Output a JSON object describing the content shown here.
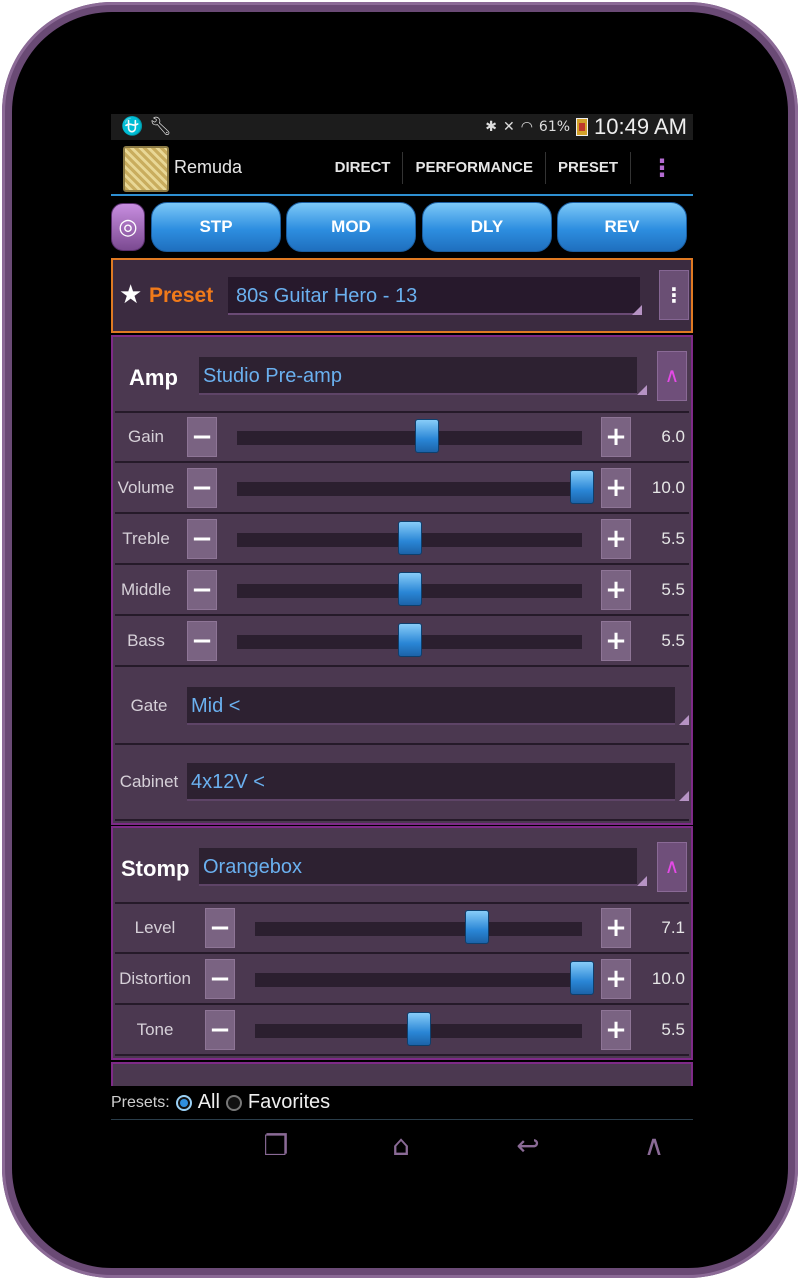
{
  "status_bar": {
    "left_icons": [
      "usb-icon",
      "wrench-icon"
    ],
    "right_icons": [
      "bluetooth-icon",
      "mute-icon",
      "wifi-icon"
    ],
    "battery": "61%",
    "time": "10:49 AM"
  },
  "action_bar": {
    "app_title": "Remuda",
    "items": [
      "DIRECT",
      "PERFORMANCE",
      "PRESET"
    ],
    "overflow": "⋮"
  },
  "tabs": [
    "STP",
    "MOD",
    "DLY",
    "REV"
  ],
  "preset": {
    "label": "Preset",
    "value": "80s Guitar Hero - 13",
    "menu": "⋮"
  },
  "amp": {
    "title": "Amp",
    "model": "Studio Pre-amp",
    "sliders": [
      {
        "label": "Gain",
        "value": "6.0",
        "level": 0.55
      },
      {
        "label": "Volume",
        "value": "10.0",
        "level": 1.0
      },
      {
        "label": "Treble",
        "value": "5.5",
        "level": 0.5
      },
      {
        "label": "Middle",
        "value": "5.5",
        "level": 0.5
      },
      {
        "label": "Bass",
        "value": "5.5",
        "level": 0.5
      }
    ],
    "gate": {
      "label": "Gate",
      "value": "Mid <"
    },
    "cabinet": {
      "label": "Cabinet",
      "value": "4x12V <"
    }
  },
  "stomp": {
    "title": "Stomp",
    "model": "Orangebox",
    "sliders": [
      {
        "label": "Level",
        "value": "7.1",
        "level": 0.68
      },
      {
        "label": "Distortion",
        "value": "10.0",
        "level": 1.0
      },
      {
        "label": "Tone",
        "value": "5.5",
        "level": 0.5
      }
    ]
  },
  "footer": {
    "label": "Presets:",
    "options": [
      "All",
      "Favorites"
    ],
    "selected": "All"
  },
  "colors": {
    "accent_blue": "#2d8ee0",
    "preset_orange": "#f07a1a",
    "panel_purple": "#4b3850",
    "device_frame": "#6a4a75"
  }
}
